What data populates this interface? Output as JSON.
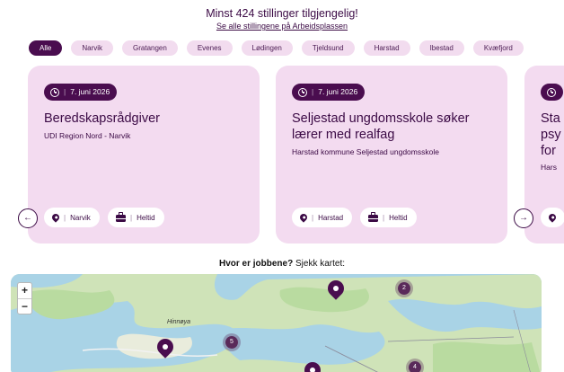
{
  "header": {
    "headline": "Minst 424 stillinger tilgjengelig!",
    "link": "Se alle stillingene på Arbeidsplassen"
  },
  "filters": [
    "Alle",
    "Narvik",
    "Gratangen",
    "Evenes",
    "Lødingen",
    "Tjeldsund",
    "Harstad",
    "Ibestad",
    "Kvæfjord"
  ],
  "active_filter": "Alle",
  "jobs": [
    {
      "date": "7. juni 2026",
      "title": "Beredskapsrådgiver",
      "employer": "UDI Region Nord - Narvik",
      "location": "Narvik",
      "type": "Heltid"
    },
    {
      "date": "7. juni 2026",
      "title": "Seljestad ungdomsskole søker lærer med realfag",
      "employer": "Harstad kommune Seljestad ungdomsskole",
      "location": "Harstad",
      "type": "Heltid"
    },
    {
      "title_partial": [
        "Sta",
        "psy",
        "for"
      ],
      "employer_partial": "Hars"
    }
  ],
  "map": {
    "heading_bold": "Hvor er jobbene?",
    "heading_rest": " Sjekk kartet:",
    "zoom_in": "+",
    "zoom_out": "−",
    "place_label": "Hinnøya",
    "clusters": [
      "2",
      "5",
      "4"
    ]
  },
  "icons": {
    "prev": "arrow-left-icon",
    "next": "arrow-right-icon",
    "clock": "clock-icon",
    "location": "pin-icon",
    "job_type": "briefcase-icon"
  },
  "colors": {
    "primary": "#4a0d4f",
    "card_bg": "#f3dbf0",
    "chip_bg": "#f2dcef",
    "water": "#a9d3e6",
    "land": "#cfe3b8"
  }
}
